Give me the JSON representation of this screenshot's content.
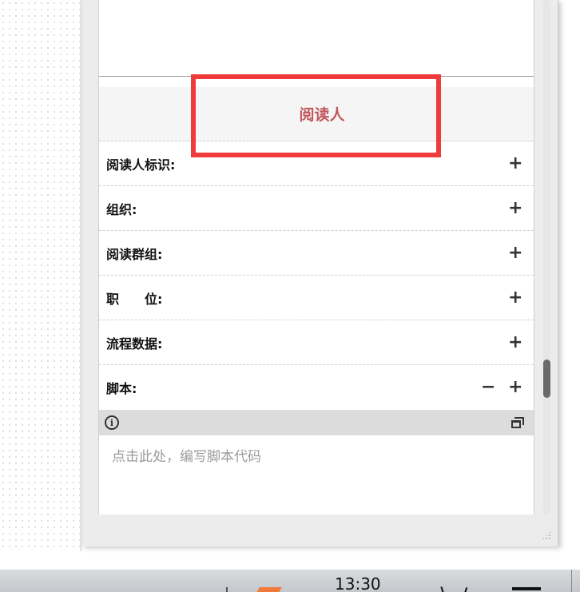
{
  "section": {
    "title": "阅读人"
  },
  "properties": [
    {
      "label": "阅读人标识:",
      "add": "+",
      "has_remove": false
    },
    {
      "label": "组织:",
      "add": "+",
      "has_remove": false
    },
    {
      "label": "阅读群组:",
      "add": "+",
      "has_remove": false
    },
    {
      "label": "职　　位:",
      "add": "+",
      "has_remove": false
    },
    {
      "label": "流程数据:",
      "add": "+",
      "has_remove": false
    },
    {
      "label": "脚本:",
      "add": "+",
      "remove": "−",
      "has_remove": true
    }
  ],
  "script": {
    "info_icon": "i",
    "placeholder": "点击此处，编写脚本代码"
  },
  "taskbar": {
    "clock": "13:30"
  },
  "colors": {
    "accent_title": "#c0575c",
    "highlight": "#ef3b3b"
  }
}
